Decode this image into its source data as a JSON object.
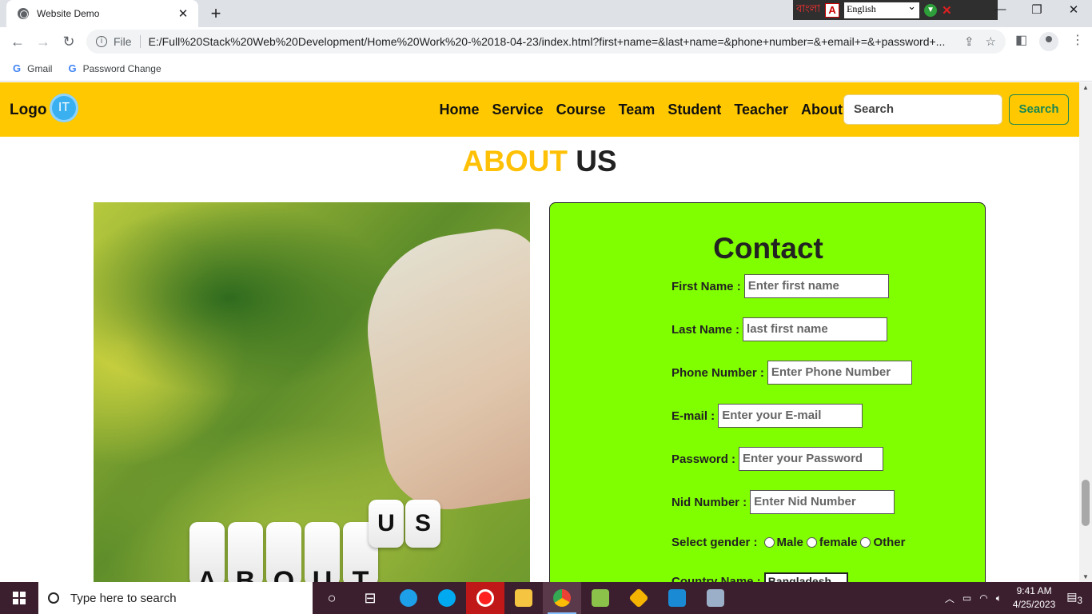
{
  "browser": {
    "tab_title": "Website Demo",
    "url_scheme_label": "File",
    "url": "E:/Full%20Stack%20Web%20Development/Home%20Work%20-%2018-04-23/index.html?first+name=&last+name=&phone+number=&+email+=&+password+...",
    "bookmarks": [
      {
        "label": "Gmail",
        "icon": "google-icon"
      },
      {
        "label": "Password Change",
        "icon": "google-icon"
      }
    ]
  },
  "extension": {
    "bangla_label": "বাংলা",
    "language_selected": "English"
  },
  "site": {
    "logo_text": "Logo",
    "logo_badge": "IT",
    "menu": [
      "Home",
      "Service",
      "Course",
      "Team",
      "Student",
      "Teacher",
      "About"
    ],
    "search_placeholder": "Search",
    "search_button": "Search",
    "section_title_a": "ABOUT",
    "section_title_b": "US",
    "image_dice_letters": [
      "A",
      "B",
      "O",
      "U",
      "T"
    ],
    "image_us_letters": [
      "U",
      "S"
    ]
  },
  "contact": {
    "title": "Contact",
    "fields": [
      {
        "label": "First Name :",
        "placeholder": "Enter first name"
      },
      {
        "label": "Last Name :",
        "placeholder": "last first name"
      },
      {
        "label": "Phone Number :",
        "placeholder": "Enter Phone Number"
      },
      {
        "label": "E-mail :",
        "placeholder": "Enter your E-mail"
      },
      {
        "label": "Password :",
        "placeholder": "Enter your Password"
      },
      {
        "label": "Nid Number :",
        "placeholder": "Enter Nid Number"
      }
    ],
    "gender_label": "Select gender :",
    "gender_options": [
      "Male",
      "female",
      "Other"
    ],
    "country_label": "Country Name :",
    "country_selected": "Bangladesh"
  },
  "taskbar": {
    "search_placeholder": "Type here to search",
    "time": "9:41 AM",
    "date": "4/25/2023",
    "notification_count": "3"
  },
  "colors": {
    "nav_bg": "#ffc800",
    "title_accent": "#ffc107",
    "contact_bg": "#80ff00",
    "search_btn": "#198754"
  }
}
